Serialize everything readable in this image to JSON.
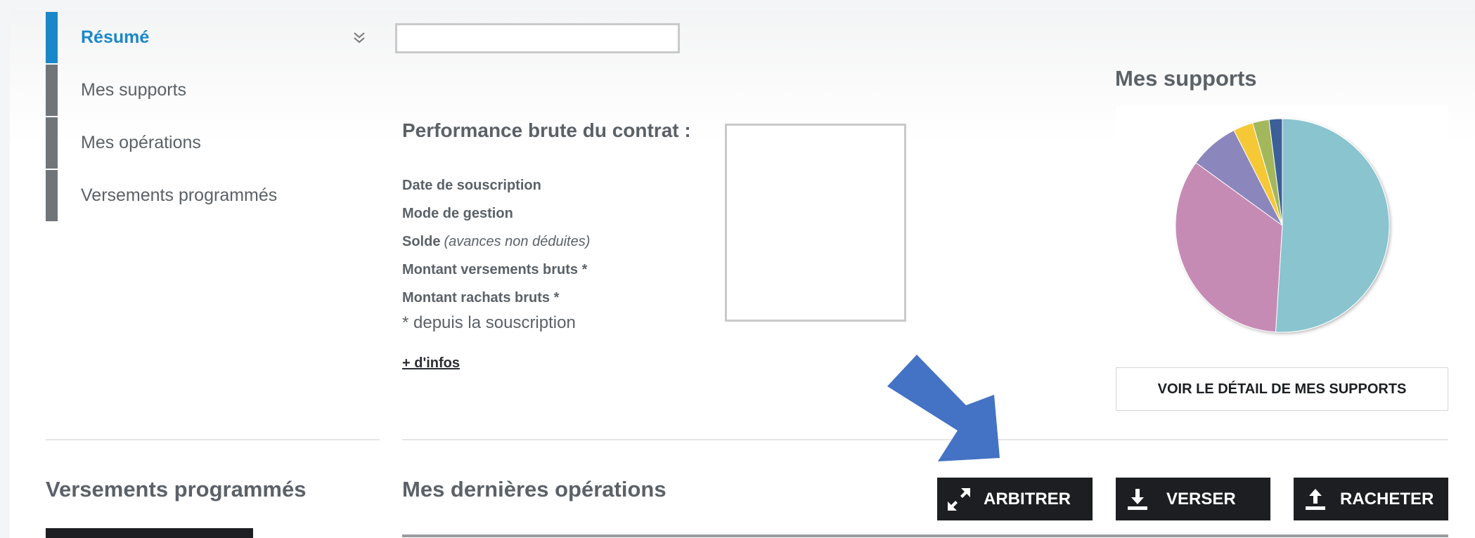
{
  "sidebar": {
    "items": [
      {
        "label": "Résumé",
        "active": true
      },
      {
        "label": "Mes supports"
      },
      {
        "label": "Mes opérations"
      },
      {
        "label": "Versements programmés"
      }
    ]
  },
  "performance": {
    "title": "Performance brute du contrat :",
    "rows": [
      {
        "label": "Date de souscription"
      },
      {
        "label": "Mode de gestion"
      },
      {
        "label": "Solde",
        "sub": "(avances non déduites)"
      },
      {
        "label": "Montant versements bruts *"
      },
      {
        "label": "Montant rachats bruts *"
      }
    ],
    "note": "* depuis la souscription",
    "more_link": "+ d'infos"
  },
  "supports": {
    "title": "Mes supports",
    "detail_button": "VOIR LE DÉTAIL DE MES SUPPORTS",
    "pie": [
      {
        "fraction": 0.51,
        "color": "#89c4cf"
      },
      {
        "fraction": 0.34,
        "color": "#c68bb4"
      },
      {
        "fraction": 0.075,
        "color": "#8b86bb"
      },
      {
        "fraction": 0.03,
        "color": "#f5c836"
      },
      {
        "fraction": 0.025,
        "color": "#a3b85c"
      },
      {
        "fraction": 0.02,
        "color": "#3c5f98"
      }
    ]
  },
  "scheduled": {
    "title": "Versements programmés"
  },
  "operations": {
    "title": "Mes dernières opérations"
  },
  "actions": {
    "arbitrer": "ARBITRER",
    "verser": "VERSER",
    "racheter": "RACHETER"
  },
  "colors": {
    "accent": "#1a87c8",
    "sidebar_bar": "#70757a",
    "button_dark": "#1c1e21",
    "annotation_arrow": "#4472c4"
  }
}
